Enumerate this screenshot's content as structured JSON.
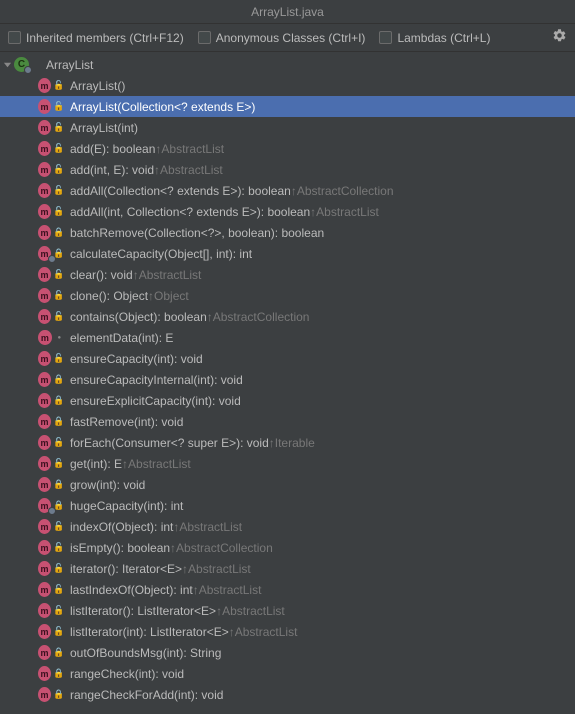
{
  "title": "ArrayList.java",
  "toolbar": {
    "inherited_label": "Inherited members (Ctrl+F12)",
    "anonymous_label": "Anonymous Classes (Ctrl+I)",
    "lambdas_label": "Lambdas (Ctrl+L)"
  },
  "class_name": "ArrayList",
  "members": [
    {
      "access": "unlock",
      "sig": "ArrayList()",
      "inherit": "",
      "sel": false,
      "ov": false
    },
    {
      "access": "unlock",
      "sig": "ArrayList(Collection<? extends E>)",
      "inherit": "",
      "sel": true,
      "ov": false
    },
    {
      "access": "unlock",
      "sig": "ArrayList(int)",
      "inherit": "",
      "sel": false,
      "ov": false
    },
    {
      "access": "unlock",
      "sig": "add(E): boolean ",
      "inherit": "↑AbstractList",
      "sel": false,
      "ov": false
    },
    {
      "access": "unlock",
      "sig": "add(int, E): void ",
      "inherit": "↑AbstractList",
      "sel": false,
      "ov": false
    },
    {
      "access": "unlock",
      "sig": "addAll(Collection<? extends E>): boolean ",
      "inherit": "↑AbstractCollection",
      "sel": false,
      "ov": false
    },
    {
      "access": "unlock",
      "sig": "addAll(int, Collection<? extends E>): boolean ",
      "inherit": "↑AbstractList",
      "sel": false,
      "ov": false
    },
    {
      "access": "lock",
      "sig": "batchRemove(Collection<?>, boolean): boolean",
      "inherit": "",
      "sel": false,
      "ov": false
    },
    {
      "access": "lock",
      "sig": "calculateCapacity(Object[], int): int",
      "inherit": "",
      "sel": false,
      "ov": true
    },
    {
      "access": "unlock",
      "sig": "clear(): void ",
      "inherit": "↑AbstractList",
      "sel": false,
      "ov": false
    },
    {
      "access": "unlock",
      "sig": "clone(): Object ",
      "inherit": "↑Object",
      "sel": false,
      "ov": false
    },
    {
      "access": "unlock",
      "sig": "contains(Object): boolean ",
      "inherit": "↑AbstractCollection",
      "sel": false,
      "ov": false
    },
    {
      "access": "dot",
      "sig": "elementData(int): E",
      "inherit": "",
      "sel": false,
      "ov": false
    },
    {
      "access": "unlock",
      "sig": "ensureCapacity(int): void",
      "inherit": "",
      "sel": false,
      "ov": false
    },
    {
      "access": "lock",
      "sig": "ensureCapacityInternal(int): void",
      "inherit": "",
      "sel": false,
      "ov": false
    },
    {
      "access": "lock",
      "sig": "ensureExplicitCapacity(int): void",
      "inherit": "",
      "sel": false,
      "ov": false
    },
    {
      "access": "lock",
      "sig": "fastRemove(int): void",
      "inherit": "",
      "sel": false,
      "ov": false
    },
    {
      "access": "unlock",
      "sig": "forEach(Consumer<? super E>): void ",
      "inherit": "↑Iterable",
      "sel": false,
      "ov": false
    },
    {
      "access": "unlock",
      "sig": "get(int): E ",
      "inherit": "↑AbstractList",
      "sel": false,
      "ov": false
    },
    {
      "access": "lock",
      "sig": "grow(int): void",
      "inherit": "",
      "sel": false,
      "ov": false
    },
    {
      "access": "lock",
      "sig": "hugeCapacity(int): int",
      "inherit": "",
      "sel": false,
      "ov": true
    },
    {
      "access": "unlock",
      "sig": "indexOf(Object): int ",
      "inherit": "↑AbstractList",
      "sel": false,
      "ov": false
    },
    {
      "access": "unlock",
      "sig": "isEmpty(): boolean ",
      "inherit": "↑AbstractCollection",
      "sel": false,
      "ov": false
    },
    {
      "access": "unlock",
      "sig": "iterator(): Iterator<E> ",
      "inherit": "↑AbstractList",
      "sel": false,
      "ov": false
    },
    {
      "access": "unlock",
      "sig": "lastIndexOf(Object): int ",
      "inherit": "↑AbstractList",
      "sel": false,
      "ov": false
    },
    {
      "access": "unlock",
      "sig": "listIterator(): ListIterator<E> ",
      "inherit": "↑AbstractList",
      "sel": false,
      "ov": false
    },
    {
      "access": "unlock",
      "sig": "listIterator(int): ListIterator<E> ",
      "inherit": "↑AbstractList",
      "sel": false,
      "ov": false
    },
    {
      "access": "lock",
      "sig": "outOfBoundsMsg(int): String",
      "inherit": "",
      "sel": false,
      "ov": false
    },
    {
      "access": "lock",
      "sig": "rangeCheck(int): void",
      "inherit": "",
      "sel": false,
      "ov": false
    },
    {
      "access": "lock",
      "sig": "rangeCheckForAdd(int): void",
      "inherit": "",
      "sel": false,
      "ov": false
    }
  ]
}
